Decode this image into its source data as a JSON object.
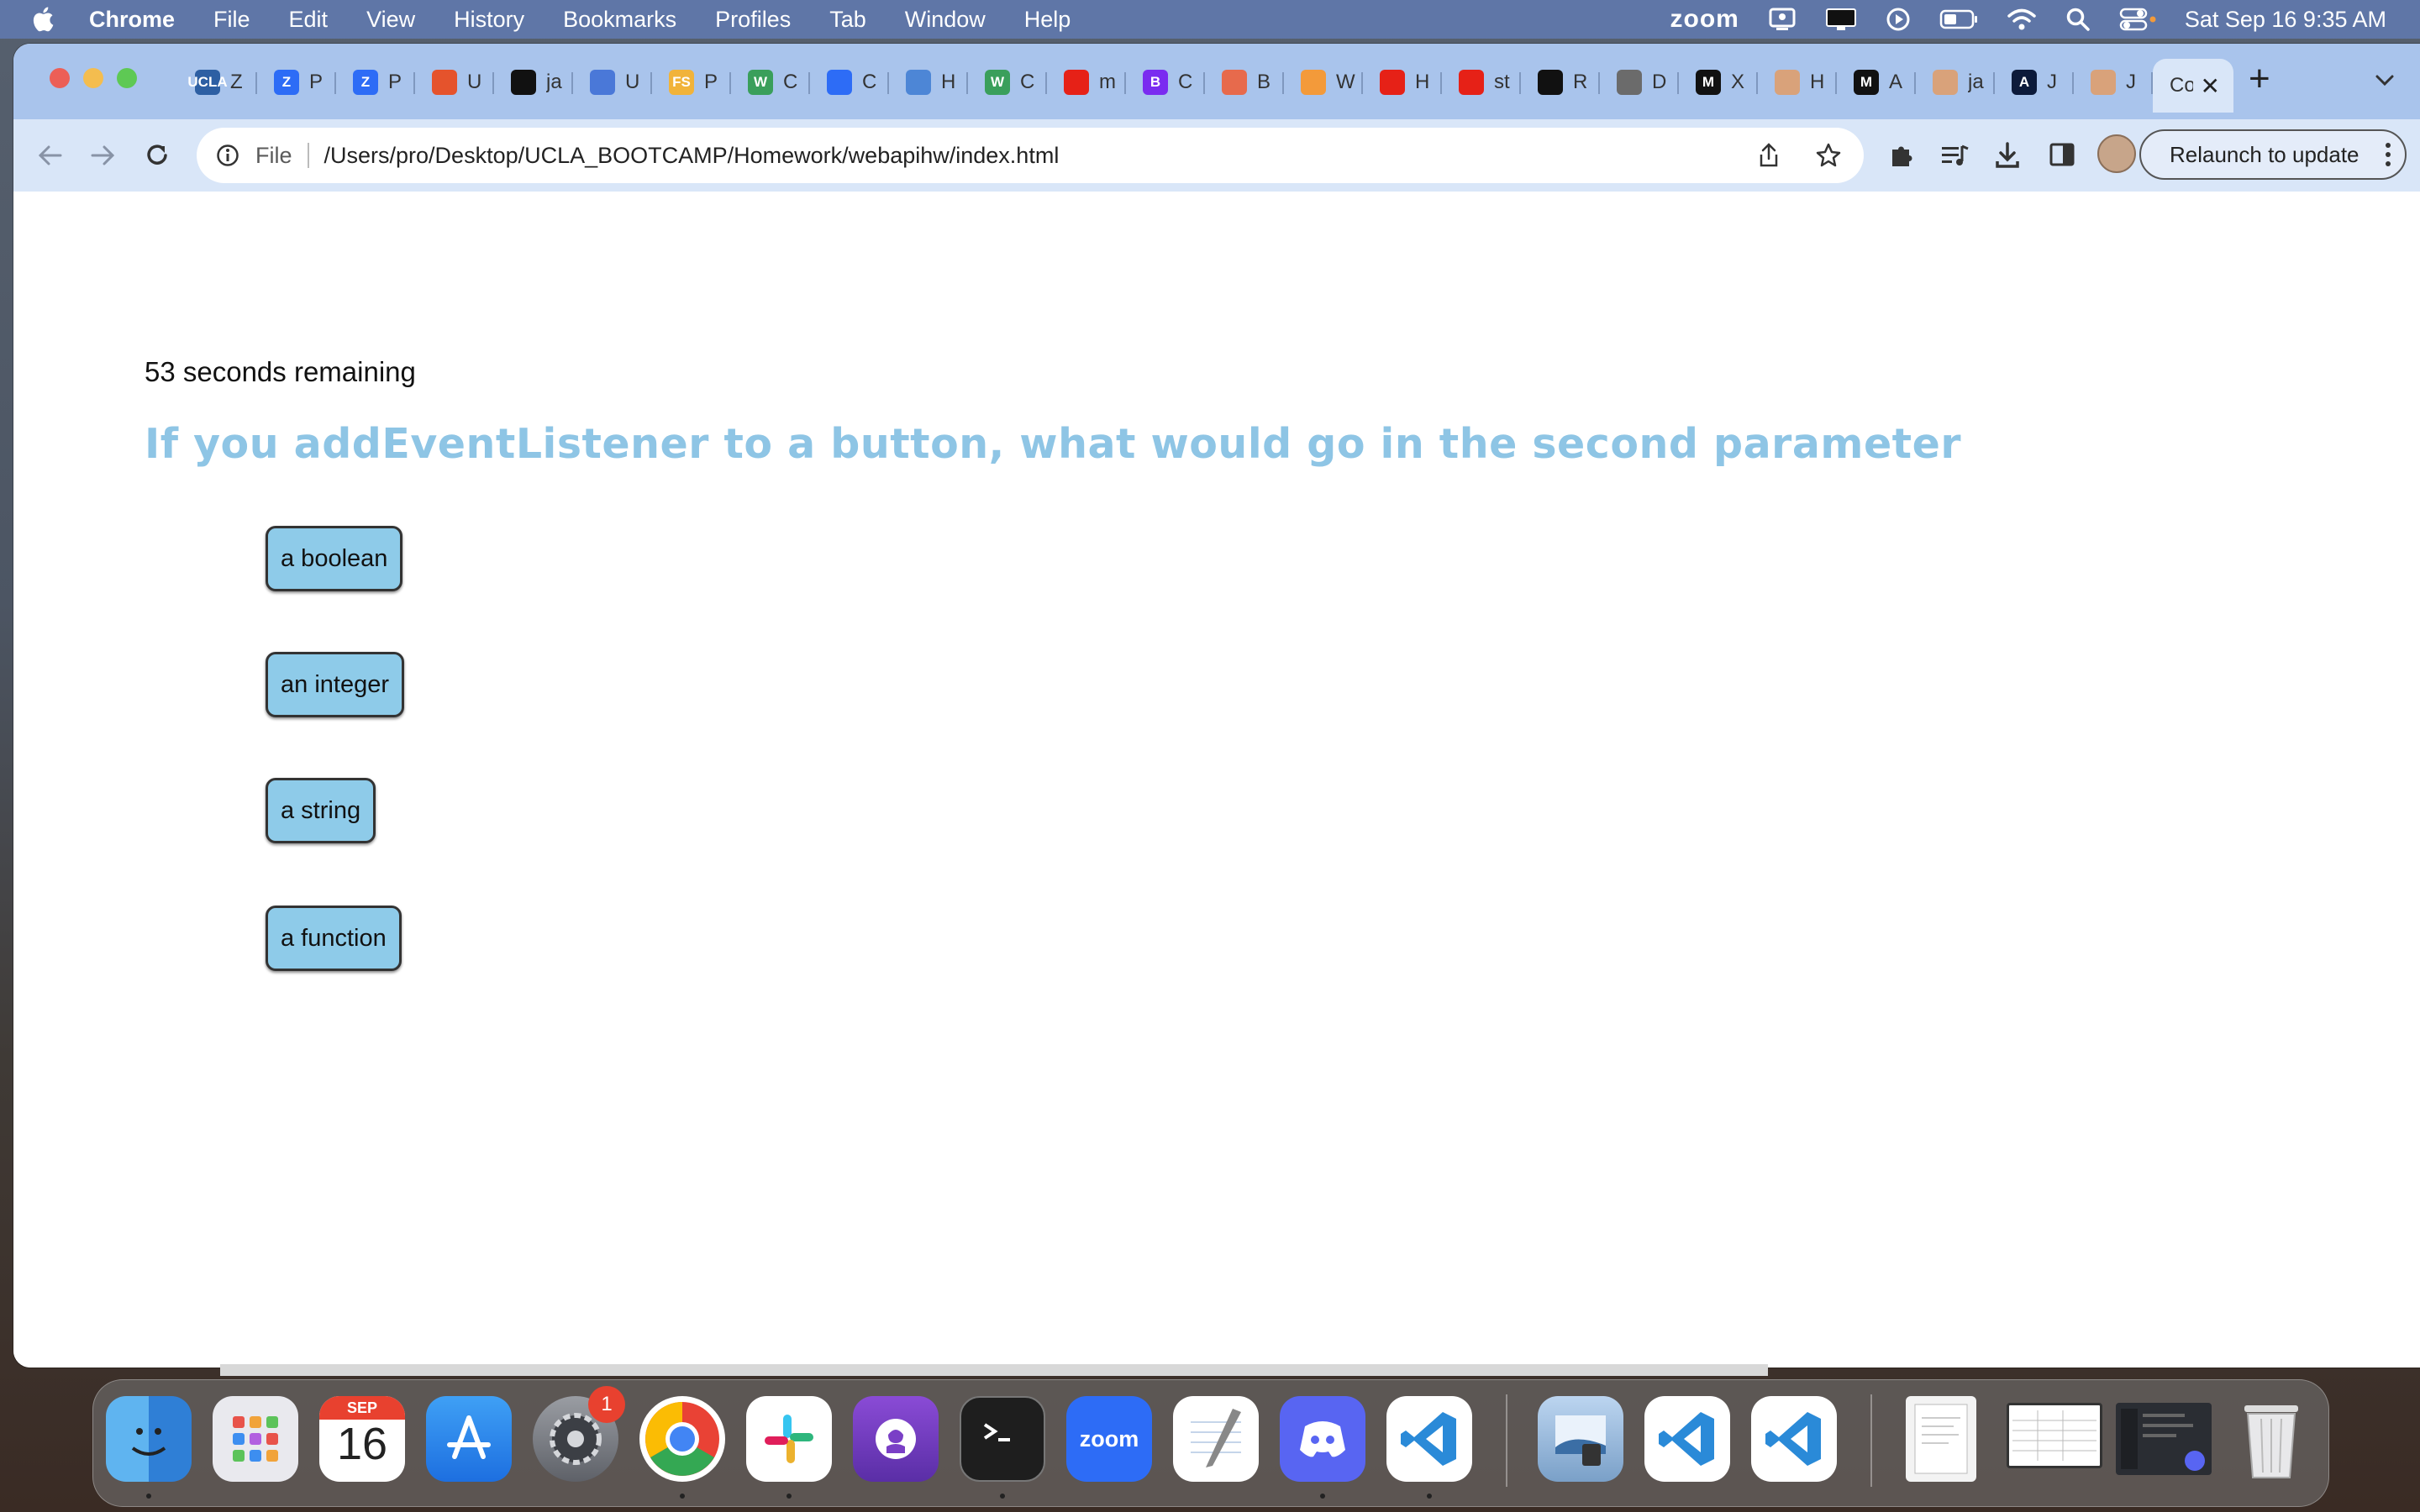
{
  "menubar": {
    "app": "Chrome",
    "items": [
      "File",
      "Edit",
      "View",
      "History",
      "Bookmarks",
      "Profiles",
      "Tab",
      "Window",
      "Help"
    ],
    "zoom_label": "zoom",
    "datetime": "Sat Sep 16  9:35 AM"
  },
  "tabs": [
    {
      "favicon_text": "UCLA",
      "favicon_color": "#2d5fa3",
      "label": "Z"
    },
    {
      "favicon_text": "Z",
      "favicon_color": "#2d6cf6",
      "label": "P"
    },
    {
      "favicon_text": "Z",
      "favicon_color": "#2d6cf6",
      "label": "P"
    },
    {
      "favicon_text": "",
      "favicon_color": "#e5532c",
      "label": "U"
    },
    {
      "favicon_text": "",
      "favicon_color": "#111111",
      "label": "ja"
    },
    {
      "favicon_text": "",
      "favicon_color": "#4a78d8",
      "label": "U"
    },
    {
      "favicon_text": "FS",
      "favicon_color": "#f1b33a",
      "label": "P"
    },
    {
      "favicon_text": "W",
      "favicon_color": "#3a9f5b",
      "label": "C"
    },
    {
      "favicon_text": "",
      "favicon_color": "#2d6cf6",
      "label": "C"
    },
    {
      "favicon_text": "",
      "favicon_color": "#4d86d6",
      "label": "H"
    },
    {
      "favicon_text": "W",
      "favicon_color": "#3a9f5b",
      "label": "C"
    },
    {
      "favicon_text": "",
      "favicon_color": "#e62117",
      "label": "m"
    },
    {
      "favicon_text": "B",
      "favicon_color": "#7a2cf0",
      "label": "C"
    },
    {
      "favicon_text": "",
      "favicon_color": "#e76a4c",
      "label": "B"
    },
    {
      "favicon_text": "",
      "favicon_color": "#f39a3a",
      "label": "W"
    },
    {
      "favicon_text": "",
      "favicon_color": "#e62117",
      "label": "H"
    },
    {
      "favicon_text": "",
      "favicon_color": "#e62117",
      "label": "st"
    },
    {
      "favicon_text": "",
      "favicon_color": "#111111",
      "label": "R"
    },
    {
      "favicon_text": "",
      "favicon_color": "#6b6b6b",
      "label": "D"
    },
    {
      "favicon_text": "M",
      "favicon_color": "#111111",
      "label": "X"
    },
    {
      "favicon_text": "",
      "favicon_color": "#d9a27a",
      "label": "H"
    },
    {
      "favicon_text": "M",
      "favicon_color": "#111111",
      "label": "A"
    },
    {
      "favicon_text": "",
      "favicon_color": "#d9a27a",
      "label": "ja"
    },
    {
      "favicon_text": "A",
      "favicon_color": "#0c1a3a",
      "label": "J"
    },
    {
      "favicon_text": "",
      "favicon_color": "#d9a27a",
      "label": "J"
    }
  ],
  "active_tab": {
    "label": "Co"
  },
  "address_bar": {
    "scheme_label": "File",
    "url": "/Users/pro/Desktop/UCLA_BOOTCAMP/Homework/webapihw/index.html"
  },
  "relaunch_label": "Relaunch to update",
  "quiz": {
    "timer_text": "53 seconds remaining",
    "question": "If you addEventListener to a button, what would go in the second parameter",
    "answers": [
      "a boolean",
      "an integer",
      "a string",
      "a function"
    ]
  },
  "dock": {
    "calendar_month": "SEP",
    "calendar_day": "16",
    "settings_badge": "1",
    "zoom_label": "zoom"
  },
  "colors": {
    "question_text": "#8ec5e5",
    "answer_button_bg": "#8ecbe9",
    "tabstrip_bg": "#a9c4ec",
    "toolbar_bg": "#d9e6f8",
    "menubar_bg": "#5f76a7"
  }
}
